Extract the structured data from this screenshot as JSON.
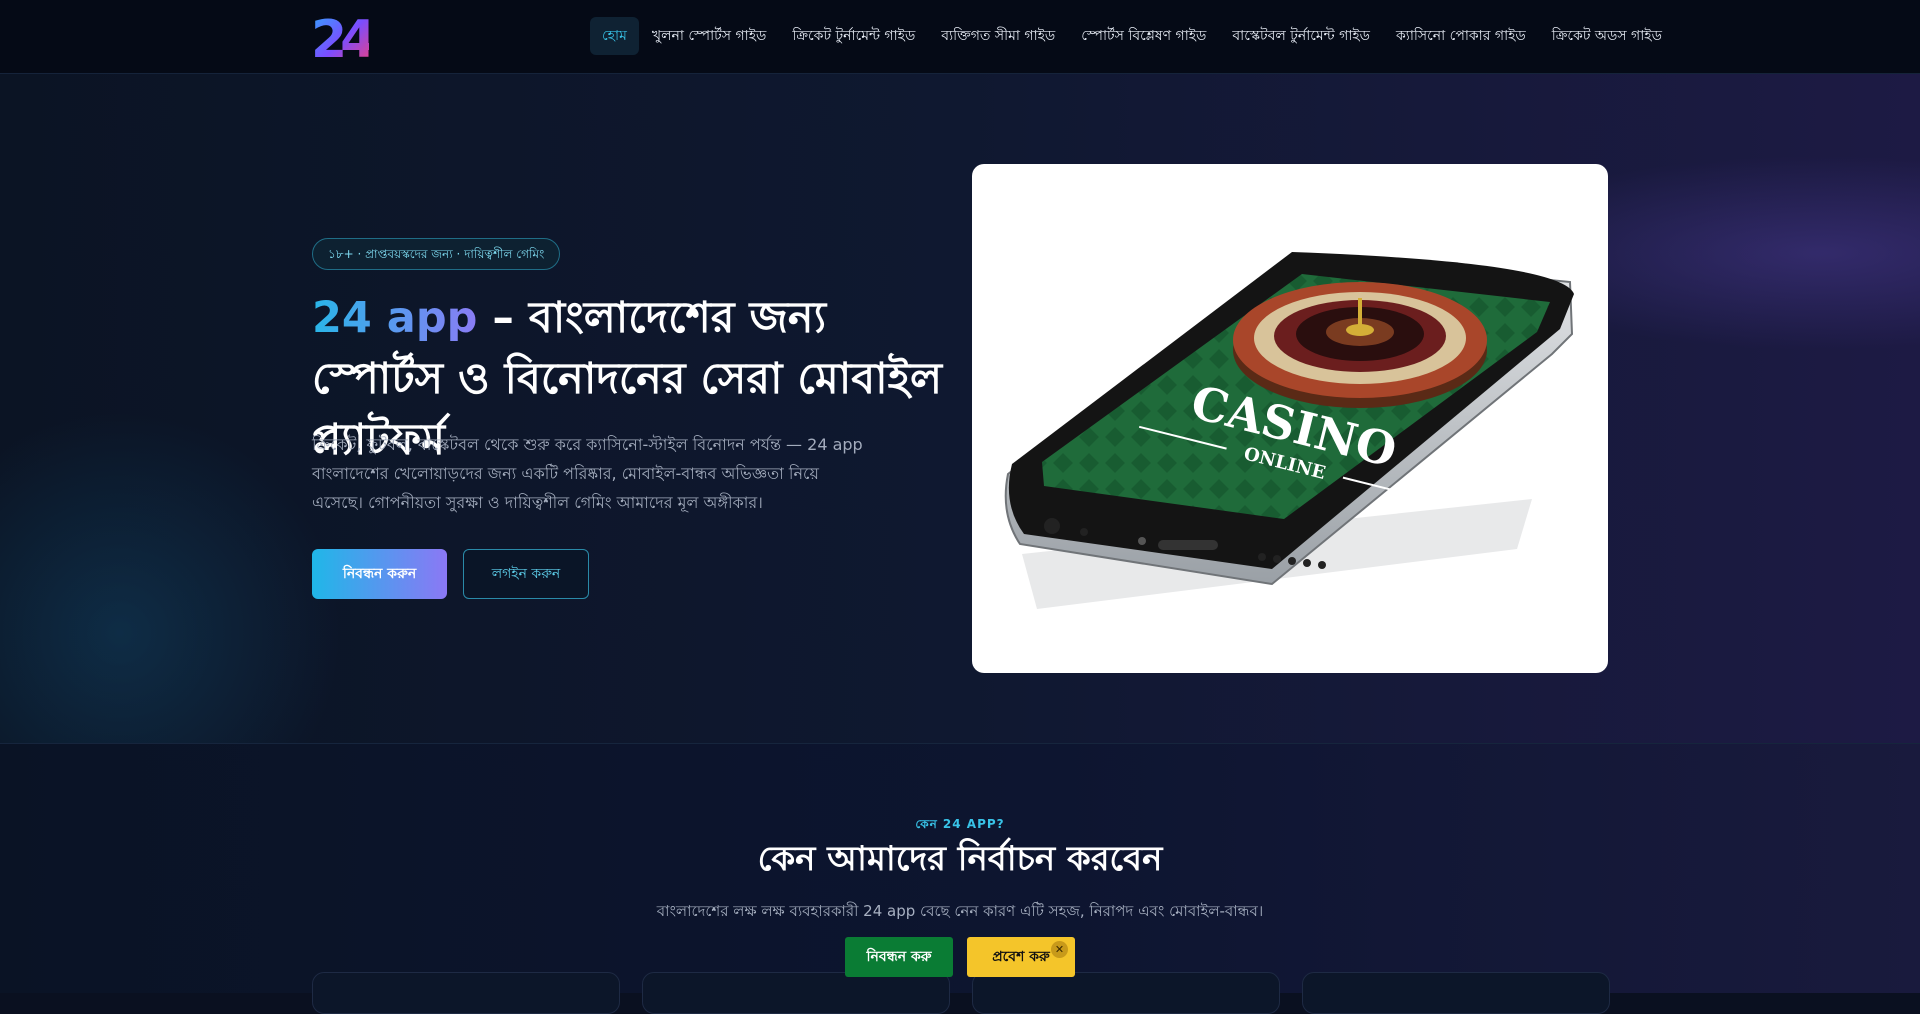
{
  "header": {
    "logo_text": "24",
    "nav": [
      {
        "label": "হোম",
        "active": true
      },
      {
        "label": "খুলনা স্পোর্টস গাইড"
      },
      {
        "label": "ক্রিকেট টুর্নামেন্ট গাইড"
      },
      {
        "label": "ব্যক্তিগত সীমা গাইড"
      },
      {
        "label": "স্পোর্টস বিশ্লেষণ গাইড"
      },
      {
        "label": "বাস্কেটবল টুর্নামেন্ট গাইড"
      },
      {
        "label": "ক্যাসিনো পোকার গাইড"
      },
      {
        "label": "ক্রিকেট অডস গাইড"
      }
    ]
  },
  "hero": {
    "badge": "১৮+ · প্রাপ্তবয়স্কদের জন্য · দায়িত্বশীল গেমিং",
    "title_brand": "24 app",
    "title_rest": " – বাংলাদেশের জন্য স্পোর্টস ও বিনোদনের সেরা মোবাইল প্ল্যাটফর্ম",
    "description": "ক্রিকেট, ফুটবল, বাস্কেটবল থেকে শুরু করে ক্যাসিনো-স্টাইল বিনোদন পর্যন্ত — 24 app বাংলাদেশের খেলোয়াড়দের জন্য একটি পরিষ্কার, মোবাইল-বান্ধব অভিজ্ঞতা নিয়ে এসেছে। গোপনীয়তা সুরক্ষা ও দায়িত্বশীল গেমিং আমাদের মূল অঙ্গীকার।",
    "register_label": "নিবন্ধন করুন",
    "login_label": "লগইন করুন",
    "image": {
      "casino_text": "CASINO",
      "online_text": "ONLINE"
    }
  },
  "why": {
    "kicker": "কেন 24 APP?",
    "title": "কেন আমাদের নির্বাচন করবেন",
    "subtitle": "বাংলাদেশের লক্ষ লক্ষ ব্যবহারকারী 24 app বেছে নেন কারণ এটি সহজ, নিরাপদ এবং মোবাইল-বান্ধব।"
  },
  "sticky": {
    "register_label": "নিবন্ধন করু",
    "enter_label": "প্রবেশ করু",
    "close_glyph": "✕"
  },
  "colors": {
    "accent_cyan": "#38c3e8",
    "accent_violet": "#8b78f5",
    "sticky_green": "#0a7c34",
    "sticky_yellow": "#f4c52a"
  }
}
